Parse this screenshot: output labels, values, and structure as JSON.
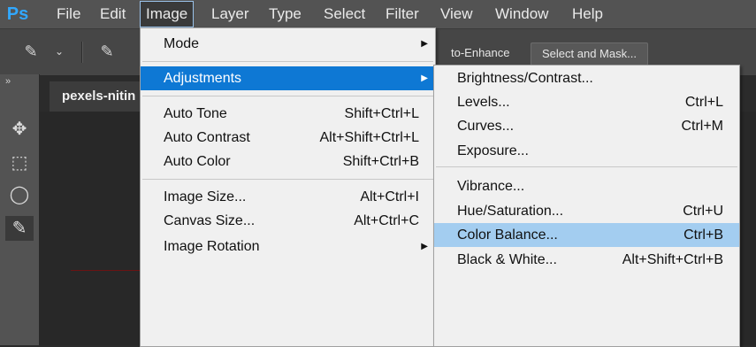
{
  "menubar": {
    "logo": "Ps",
    "items": [
      "File",
      "Edit",
      "Image",
      "Layer",
      "Type",
      "Select",
      "Filter",
      "View",
      "Window",
      "Help"
    ]
  },
  "options": {
    "auto_enhance": "to-Enhance",
    "select_mask": "Select and Mask..."
  },
  "document": {
    "tab_title": "pexels-nitin"
  },
  "image_menu": {
    "mode": "Mode",
    "adjustments": "Adjustments",
    "auto_tone": {
      "label": "Auto Tone",
      "shortcut": "Shift+Ctrl+L"
    },
    "auto_contrast": {
      "label": "Auto Contrast",
      "shortcut": "Alt+Shift+Ctrl+L"
    },
    "auto_color": {
      "label": "Auto Color",
      "shortcut": "Shift+Ctrl+B"
    },
    "image_size": {
      "label": "Image Size...",
      "shortcut": "Alt+Ctrl+I"
    },
    "canvas_size": {
      "label": "Canvas Size...",
      "shortcut": "Alt+Ctrl+C"
    },
    "image_rotation": "Image Rotation"
  },
  "adjust_menu": {
    "brightness": {
      "label": "Brightness/Contrast...",
      "shortcut": ""
    },
    "levels": {
      "label": "Levels...",
      "shortcut": "Ctrl+L"
    },
    "curves": {
      "label": "Curves...",
      "shortcut": "Ctrl+M"
    },
    "exposure": {
      "label": "Exposure...",
      "shortcut": ""
    },
    "vibrance": {
      "label": "Vibrance...",
      "shortcut": ""
    },
    "hue_saturation": {
      "label": "Hue/Saturation...",
      "shortcut": "Ctrl+U"
    },
    "color_balance": {
      "label": "Color Balance...",
      "shortcut": "Ctrl+B"
    },
    "black_white": {
      "label": "Black & White...",
      "shortcut": "Alt+Shift+Ctrl+B"
    }
  }
}
